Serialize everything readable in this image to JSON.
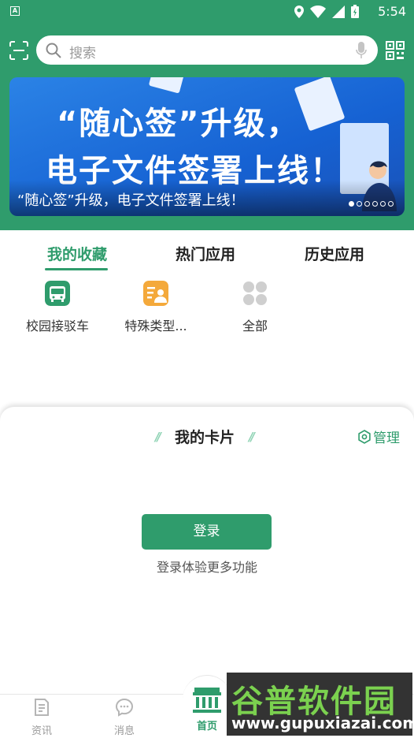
{
  "status": {
    "time": "5:54",
    "app_badge": "A"
  },
  "search": {
    "placeholder": "搜索"
  },
  "banner": {
    "headline1": "“随心签”升级，",
    "headline2": "电子文件签署上线！",
    "caption": "“随心签”升级，电子文件签署上线！",
    "slide_count": 6,
    "active_slide": 1
  },
  "tabs": [
    {
      "label": "我的收藏",
      "active": true
    },
    {
      "label": "热门应用",
      "active": false
    },
    {
      "label": "历史应用",
      "active": false
    }
  ],
  "apps": [
    {
      "label": "校园接驳车",
      "icon": "bus-icon",
      "color": "#2f9c6c"
    },
    {
      "label": "特殊类型...",
      "icon": "id-card-icon",
      "color": "#f4a93b"
    },
    {
      "label": "全部",
      "icon": "grid-icon",
      "color": "#c8c8c8"
    }
  ],
  "cards": {
    "title": "我的卡片",
    "manage_label": "管理"
  },
  "login": {
    "button_label": "登录",
    "hint": "登录体验更多功能"
  },
  "bottom_nav": [
    {
      "label": "资讯",
      "icon": "news-icon"
    },
    {
      "label": "消息",
      "icon": "message-icon"
    },
    {
      "label": "首页",
      "icon": "home-icon",
      "active": true
    }
  ],
  "watermark": {
    "name": "谷普软件园",
    "url": "www.gupuxiazai.com"
  },
  "colors": {
    "primary": "#2f9c6c",
    "banner_blue": "#1662d3"
  }
}
